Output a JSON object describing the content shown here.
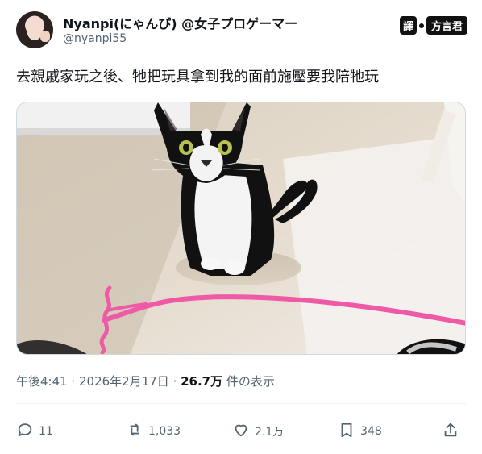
{
  "author": {
    "display_name": "Nyanpi(にゃんぴ) @女子プロゲーマー",
    "handle": "@nyanpi55"
  },
  "badge": {
    "left": "譯",
    "right": "方言君"
  },
  "tweet": {
    "text": "去親戚家玩之後、牠把玩具拿到我的面前施壓要我陪牠玩"
  },
  "meta": {
    "time_date": "午後4:41 · 2026年2月17日 · ",
    "views": "26.7万",
    "views_suffix": " 件の表示"
  },
  "actions": {
    "replies": "11",
    "reposts": "1,033",
    "likes": "2.1万",
    "bookmarks": "348"
  },
  "icons": [
    "reply-icon",
    "repost-icon",
    "like-icon",
    "bookmark-icon",
    "share-icon"
  ]
}
